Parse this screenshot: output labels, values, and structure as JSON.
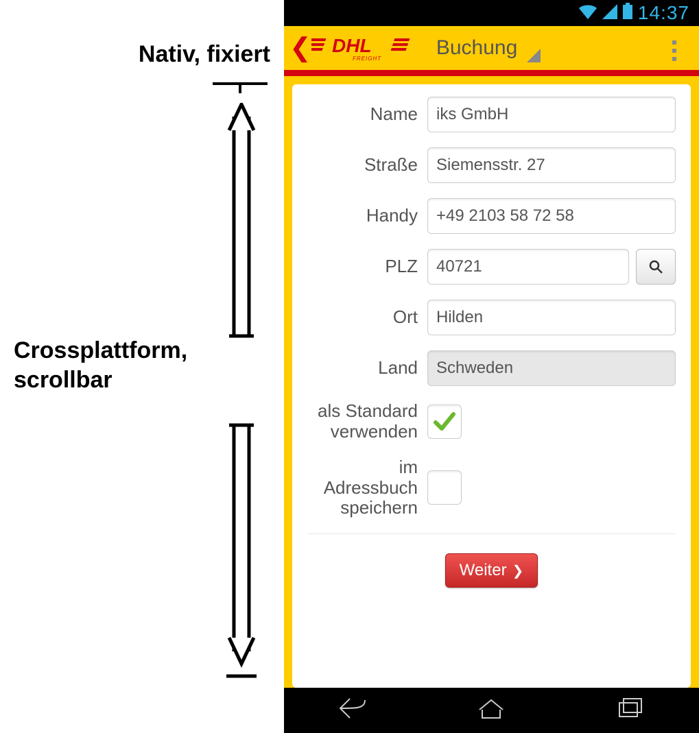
{
  "annotations": {
    "top": "Nativ, fixiert",
    "mid_line1": "Crossplattform,",
    "mid_line2": "scrollbar"
  },
  "status_bar": {
    "time": "14:37",
    "icons": {
      "wifi": "wifi-icon",
      "cell": "cell-icon",
      "battery": "battery-icon"
    }
  },
  "action_bar": {
    "logo_text": "DHL",
    "logo_sub": "FREIGHT",
    "title": "Buchung"
  },
  "form": {
    "fields": {
      "name": {
        "label": "Name",
        "value": "iks GmbH"
      },
      "street": {
        "label": "Straße",
        "value": "Siemensstr. 27"
      },
      "mobile": {
        "label": "Handy",
        "value": "+49 2103 58 72 58"
      },
      "zip": {
        "label": "PLZ",
        "value": "40721"
      },
      "city": {
        "label": "Ort",
        "value": "Hilden"
      },
      "country": {
        "label": "Land",
        "value": "Schweden"
      }
    },
    "checkboxes": {
      "use_default": {
        "label_line1": "als Standard",
        "label_line2": "verwenden",
        "checked": true
      },
      "save_address": {
        "label_line1": "im Adressbuch",
        "label_line2": "speichern",
        "checked": false
      }
    },
    "submit_label": "Weiter"
  },
  "colors": {
    "dhl_yellow": "#ffcc00",
    "dhl_red": "#d40511",
    "holo_blue": "#33b5e5"
  }
}
